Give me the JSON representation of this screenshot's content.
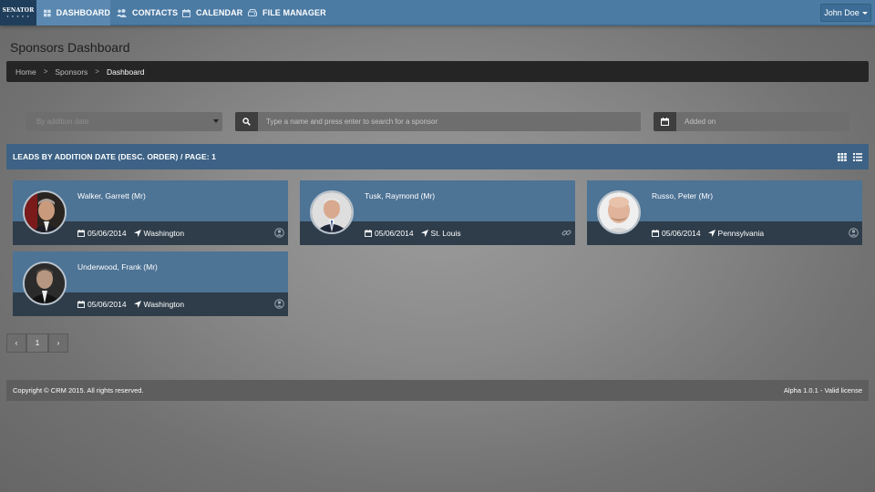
{
  "brand": {
    "name": "SENATOR",
    "tag": "★ ★ ★ ★ ★"
  },
  "nav": {
    "items": [
      {
        "label": "DASHBOARD",
        "icon": "dashboard-icon",
        "active": true
      },
      {
        "label": "CONTACTS",
        "icon": "users-icon",
        "active": false
      },
      {
        "label": "CALENDAR",
        "icon": "calendar-icon",
        "active": false
      },
      {
        "label": "FILE MANAGER",
        "icon": "hdd-icon",
        "active": false
      }
    ],
    "user": "John Doe"
  },
  "page": {
    "title": "Sponsors Dashboard"
  },
  "breadcrumb": {
    "items": [
      "Home",
      "Sponsors",
      "Dashboard"
    ]
  },
  "filters": {
    "sort_select": "By addition date",
    "search_placeholder": "Type a name and press enter to search for a sponsor",
    "date_placeholder": "Added on"
  },
  "panel": {
    "title": "LEADS BY ADDITION DATE (DESC. ORDER) / PAGE: 1"
  },
  "sponsors": [
    {
      "name": "Walker, Garrett (Mr)",
      "date": "05/06/2014",
      "location": "Washington",
      "status_icon": "user-circle-icon"
    },
    {
      "name": "Tusk, Raymond (Mr)",
      "date": "05/06/2014",
      "location": "St. Louis",
      "status_icon": "link-icon"
    },
    {
      "name": "Russo, Peter (Mr)",
      "date": "05/06/2014",
      "location": "Pennsylvania",
      "status_icon": "user-circle-icon"
    },
    {
      "name": "Underwood, Frank (Mr)",
      "date": "05/06/2014",
      "location": "Washington",
      "status_icon": "user-circle-icon"
    }
  ],
  "pagination": {
    "prev": "‹",
    "current": "1",
    "next": "›"
  },
  "footer": {
    "copyright": "Copyright © CRM 2015. All rights reserved.",
    "version": "Alpha 1.0.1 - Valid license"
  },
  "colors": {
    "navbar": "#4b7aa3",
    "panel_header": "#3d6285",
    "card_top": "#4d7395",
    "card_bottom": "#2f3d4a"
  }
}
